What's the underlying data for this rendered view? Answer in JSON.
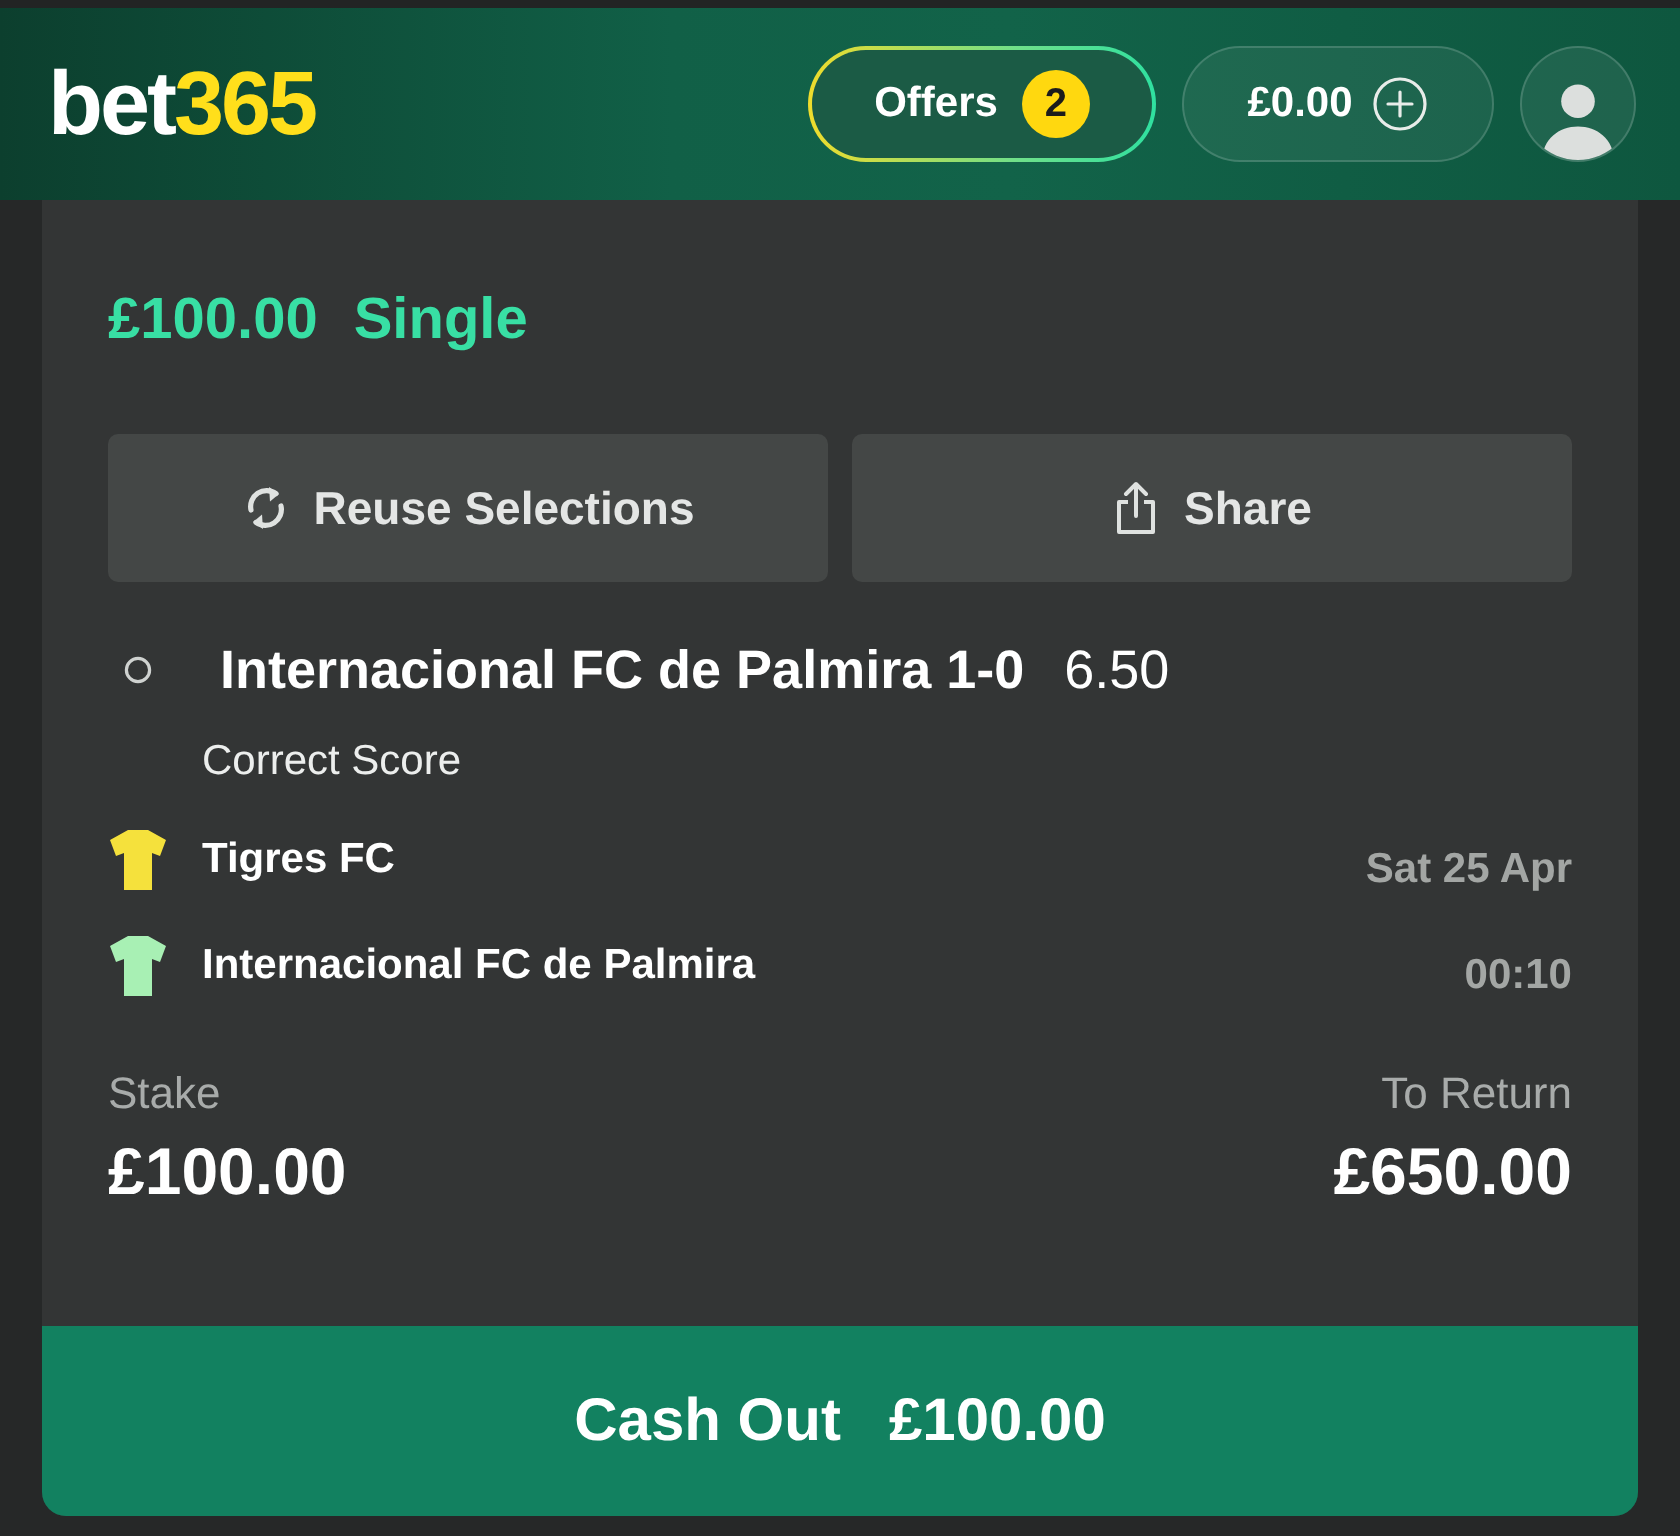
{
  "header": {
    "logo": {
      "text": "bet",
      "accent": "365"
    },
    "offers": {
      "label": "Offers",
      "count": "2"
    },
    "balance": {
      "amount": "£0.00"
    }
  },
  "bet": {
    "stake_title": "£100.00",
    "type": "Single",
    "actions": [
      {
        "kind": "reuse",
        "label": "Reuse Selections"
      },
      {
        "kind": "share",
        "label": "Share"
      }
    ],
    "selection": {
      "name": "Internacional FC de Palmira 1-0",
      "odds": "6.50",
      "market": "Correct Score"
    },
    "teams": [
      {
        "name": "Tigres FC",
        "color": "#f5e13c"
      },
      {
        "name": "Internacional FC de Palmira",
        "color": "#a8f0b4"
      }
    ],
    "date": "Sat 25 Apr",
    "time": "00:10",
    "stake": {
      "label": "Stake",
      "value": "£100.00"
    },
    "return": {
      "label": "To Return",
      "value": "£650.00"
    },
    "cash_out": {
      "label": "Cash Out",
      "amount": "£100.00"
    }
  }
}
